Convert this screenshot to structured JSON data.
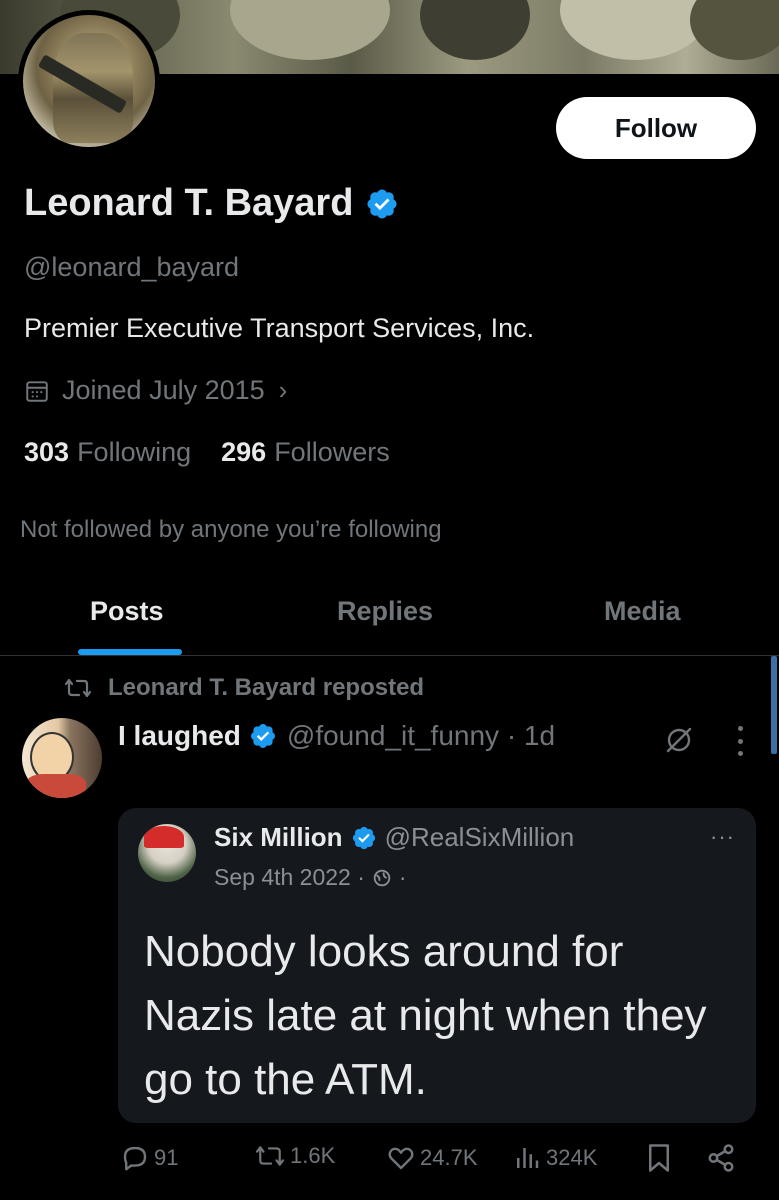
{
  "profile": {
    "name": "Leonard T. Bayard",
    "handle": "@leonard_bayard",
    "bio": "Premier Executive Transport Services, Inc.",
    "joined": "Joined July 2015",
    "following_count": "303",
    "following_label": "Following",
    "followers_count": "296",
    "followers_label": "Followers",
    "not_followed_text": "Not followed by anyone you’re following",
    "follow_label": "Follow",
    "verified_color": "#1d9bf0"
  },
  "tabs": [
    {
      "label": "Posts",
      "active": true
    },
    {
      "label": "Replies",
      "active": false
    },
    {
      "label": "Media",
      "active": false
    }
  ],
  "post": {
    "repost_text": "Leonard T. Bayard reposted",
    "author_name": "I laughed",
    "author_meta": "@found_it_funny · 1d",
    "quote": {
      "name": "Six Million",
      "handle": "@RealSixMillion",
      "date": "Sep 4th 2022 ·",
      "text": "Nobody looks around for Nazis late at night when they go to the ATM.",
      "more": "···"
    },
    "actions": {
      "replies": "91",
      "reposts": "1.6K",
      "likes": "24.7K",
      "views": "324K"
    }
  },
  "icons": [
    "calendar-icon",
    "chevron-right-icon",
    "verified-badge-icon",
    "repost-icon",
    "grok-icon",
    "more-vertical-icon",
    "globe-icon",
    "reply-icon",
    "like-icon",
    "views-icon",
    "bookmark-icon",
    "share-icon"
  ]
}
